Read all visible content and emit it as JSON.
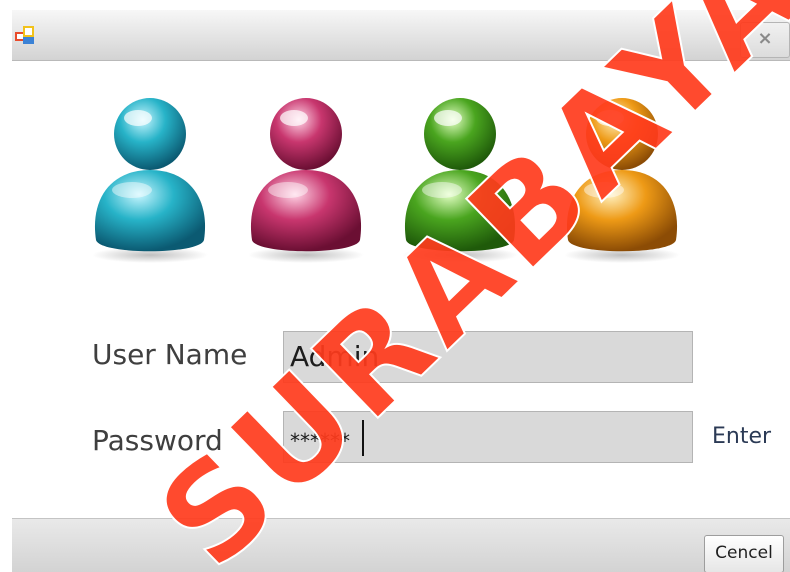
{
  "window": {
    "close_glyph": "×"
  },
  "icons": [
    "app-icon",
    "close-icon",
    "user-icon-cyan",
    "user-icon-pink",
    "user-icon-green",
    "user-icon-orange"
  ],
  "colors": {
    "cyan": "#27b3c8",
    "pink": "#c8366e",
    "green": "#4aa51f",
    "orange": "#ee9a16",
    "watermark": "#ff3b1c"
  },
  "form": {
    "username_label": "User Name",
    "username_value": "Admin",
    "password_label": "Password",
    "password_value": "******",
    "enter_label": "Enter"
  },
  "footer": {
    "cancel_label": "Cencel"
  },
  "watermark": {
    "text": "SURABAYA"
  }
}
